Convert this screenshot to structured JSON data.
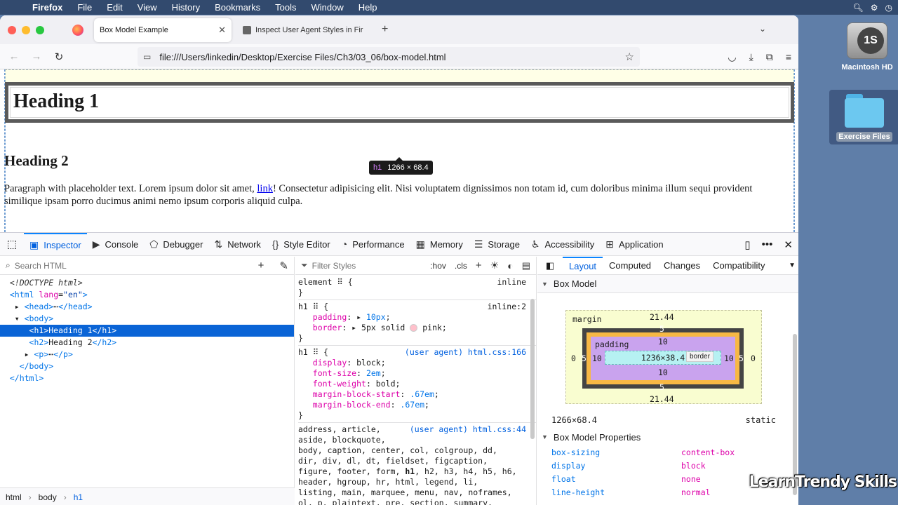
{
  "menubar": {
    "apple": "",
    "items": [
      "Firefox",
      "File",
      "Edit",
      "View",
      "History",
      "Bookmarks",
      "Tools",
      "Window",
      "Help"
    ]
  },
  "desktop": {
    "hd_label": "Macintosh HD",
    "hd_badge": "1S",
    "folder_label": "Exercise Files"
  },
  "tabs": {
    "active_title": "Box Model Example",
    "inactive_title": "Inspect User Agent Styles in Fir"
  },
  "url": "file:///Users/linkedin/Desktop/Exercise Files/Ch3/03_06/box-model.html",
  "page": {
    "h1": "Heading 1",
    "h2": "Heading 2",
    "p_before": "Paragraph with placeholder text. Lorem ipsum dolor sit amet, ",
    "p_link": "link",
    "p_after": "! Consectetur adipisicing elit. Nisi voluptatem dignissimos non totam id, cum doloribus minima illum sequi provident similique ipsam porro ducimus animi nemo ipsum corporis aliquid culpa.",
    "tooltip_tag": "h1",
    "tooltip_size": "1266 × 68.4"
  },
  "devtools": {
    "tabs": [
      "Inspector",
      "Console",
      "Debugger",
      "Network",
      "Style Editor",
      "Performance",
      "Memory",
      "Storage",
      "Accessibility",
      "Application"
    ],
    "search_placeholder": "Search HTML",
    "filter_placeholder": "Filter Styles",
    "hov": ":hov",
    "cls": ".cls",
    "breadcrumbs": [
      "html",
      "body",
      "h1"
    ],
    "sub_tabs": [
      "Layout",
      "Computed",
      "Changes",
      "Compatibility"
    ],
    "box_model_title": "Box Model",
    "box_model": {
      "margin_label": "margin",
      "border_label": "border",
      "padding_label": "padding",
      "margin_top": "21.44",
      "margin_bottom": "21.44",
      "margin_left": "0",
      "margin_right": "0",
      "border_top": "5",
      "border_bottom": "5",
      "border_left": "5",
      "border_right": "5",
      "padding_top": "10",
      "padding_bottom": "10",
      "padding_left": "10",
      "padding_right": "10",
      "content": "1236×38.4",
      "size": "1266×68.4",
      "position": "static"
    },
    "props_title": "Box Model Properties",
    "props": [
      {
        "name": "box-sizing",
        "value": "content-box"
      },
      {
        "name": "display",
        "value": "block"
      },
      {
        "name": "float",
        "value": "none"
      },
      {
        "name": "line-height",
        "value": "normal"
      }
    ]
  },
  "watermark": "LearnTrendy Skills"
}
